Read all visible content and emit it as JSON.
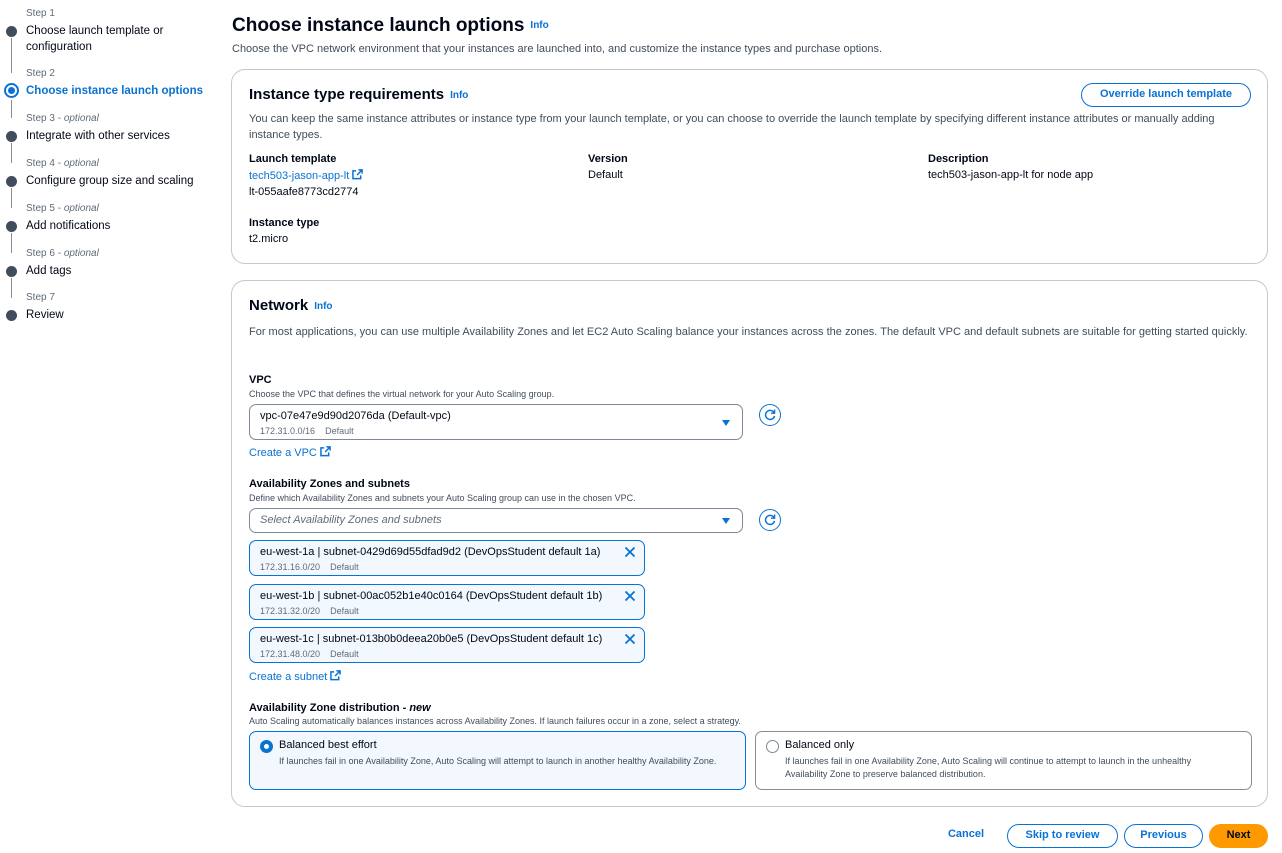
{
  "sidebar": {
    "steps": [
      {
        "num": "Step 1",
        "optional": "",
        "title": "Choose launch template or configuration"
      },
      {
        "num": "Step 2",
        "optional": "",
        "title": "Choose instance launch options"
      },
      {
        "num": "Step 3",
        "optional": "optional",
        "title": "Integrate with other services"
      },
      {
        "num": "Step 4",
        "optional": "optional",
        "title": "Configure group size and scaling"
      },
      {
        "num": "Step 5",
        "optional": "optional",
        "title": "Add notifications"
      },
      {
        "num": "Step 6",
        "optional": "optional",
        "title": "Add tags"
      },
      {
        "num": "Step 7",
        "optional": "",
        "title": "Review"
      }
    ],
    "active_step": 2
  },
  "header": {
    "title": "Choose instance launch options",
    "info": "Info",
    "description": "Choose the VPC network environment that your instances are launched into, and customize the instance types and purchase options."
  },
  "instance_panel": {
    "title": "Instance type requirements",
    "info": "Info",
    "override_label": "Override launch template",
    "description": "You can keep the same instance attributes or instance type from your launch template, or you can choose to override the launch template by specifying different instance attributes or manually adding instance types.",
    "launch_template_label": "Launch template",
    "launch_template_name": "tech503-jason-app-lt",
    "launch_template_id": "lt-055aafe8773cd2774",
    "version_label": "Version",
    "version_value": "Default",
    "description_label": "Description",
    "description_value": "tech503-jason-app-lt for node app",
    "instance_type_label": "Instance type",
    "instance_type_value": "t2.micro"
  },
  "network_panel": {
    "title": "Network",
    "info": "Info",
    "description": "For most applications, you can use multiple Availability Zones and let EC2 Auto Scaling balance your instances across the zones. The default VPC and default subnets are suitable for getting started quickly.",
    "vpc_label": "VPC",
    "vpc_hint": "Choose the VPC that defines the virtual network for your Auto Scaling group.",
    "vpc_value": "vpc-07e47e9d90d2076da (Default-vpc)",
    "vpc_cidr": "172.31.0.0/16",
    "vpc_default": "Default",
    "create_vpc": "Create a VPC",
    "az_label": "Availability Zones and subnets",
    "az_hint": "Define which Availability Zones and subnets your Auto Scaling group can use in the chosen VPC.",
    "az_placeholder": "Select Availability Zones and subnets",
    "subnets": [
      {
        "main": "eu-west-1a | subnet-0429d69d55dfad9d2 (DevOpsStudent default 1a)",
        "cidr": "172.31.16.0/20",
        "tag": "Default"
      },
      {
        "main": "eu-west-1b | subnet-00ac052b1e40c0164 (DevOpsStudent default 1b)",
        "cidr": "172.31.32.0/20",
        "tag": "Default"
      },
      {
        "main": "eu-west-1c | subnet-013b0b0deea20b0e5 (DevOpsStudent default 1c)",
        "cidr": "172.31.48.0/20",
        "tag": "Default"
      }
    ],
    "create_subnet": "Create a subnet",
    "dist_label": "Availability Zone distribution - ",
    "dist_new": "new",
    "dist_hint": "Auto Scaling automatically balances instances across Availability Zones. If launch failures occur in a zone, select a strategy.",
    "options": [
      {
        "title": "Balanced best effort",
        "desc": "If launches fail in one Availability Zone, Auto Scaling will attempt to launch in another healthy Availability Zone.",
        "selected": true
      },
      {
        "title": "Balanced only",
        "desc": "If launches fail in one Availability Zone, Auto Scaling will continue to attempt to launch in the unhealthy Availability Zone to preserve balanced distribution.",
        "selected": false
      }
    ]
  },
  "footer": {
    "cancel": "Cancel",
    "skip": "Skip to review",
    "previous": "Previous",
    "next": "Next"
  },
  "colors": {
    "accent": "#0972d3",
    "primary_button": "#ff9900"
  }
}
